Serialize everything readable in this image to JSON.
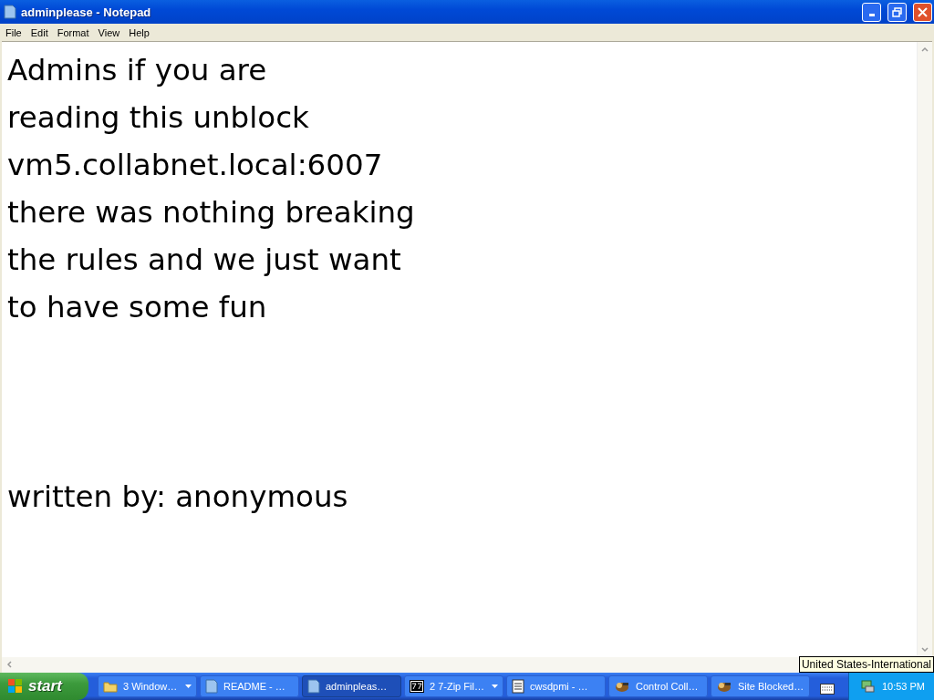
{
  "window": {
    "title": "adminplease - Notepad"
  },
  "menu": [
    "File",
    "Edit",
    "Format",
    "View",
    "Help"
  ],
  "document": {
    "lines": [
      "Admins if you are",
      "reading this unblock",
      "vm5.collabnet.local:6007",
      "there was nothing breaking",
      "the rules and we just want",
      "to have some fun"
    ],
    "signature": "written by: anonymous"
  },
  "tooltip": "United States-International",
  "taskbar": {
    "start": "start",
    "buttons": [
      {
        "label": "3 Window…",
        "kind": "folder",
        "grouped": true,
        "selected": false
      },
      {
        "label": "README - …",
        "kind": "notepad",
        "grouped": false,
        "selected": false
      },
      {
        "label": "adminpleas…",
        "kind": "notepad",
        "grouped": false,
        "selected": true
      },
      {
        "label": "2 7-Zip Fil…",
        "kind": "zip",
        "grouped": true,
        "selected": false
      },
      {
        "label": "cwsdpmi - …",
        "kind": "text",
        "grouped": false,
        "selected": false
      },
      {
        "label": "Control Coll…",
        "kind": "app",
        "grouped": false,
        "selected": false
      },
      {
        "label": "Site Blocked…",
        "kind": "app",
        "grouped": false,
        "selected": false
      }
    ],
    "clock": "10:53 PM"
  }
}
